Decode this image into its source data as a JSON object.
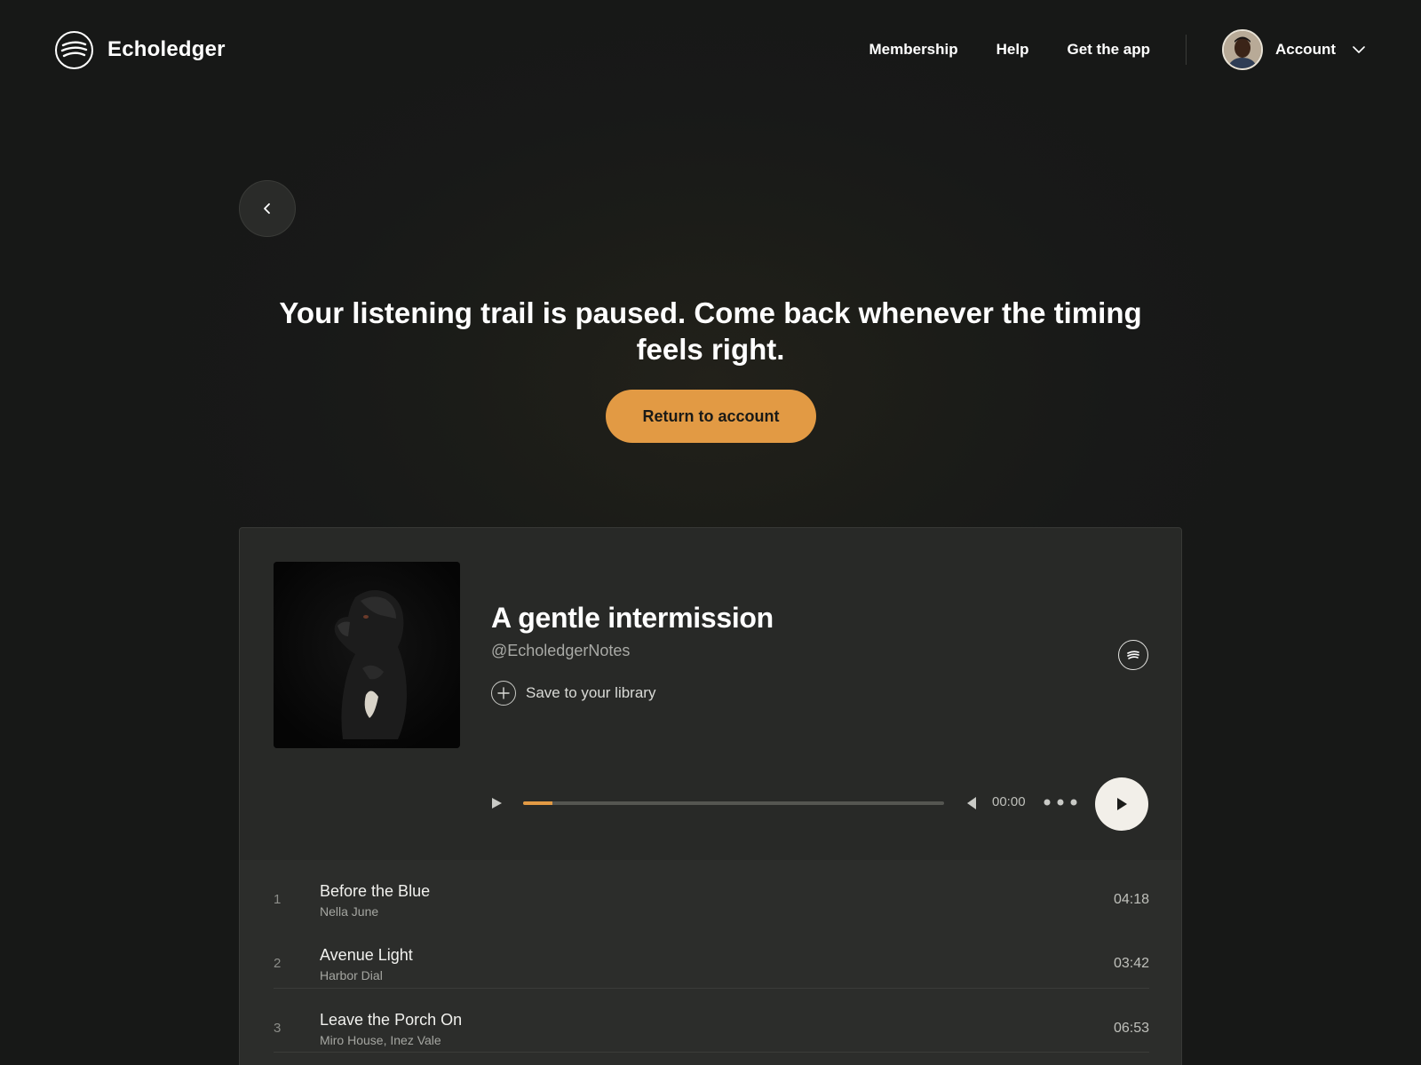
{
  "header": {
    "brand": "Echoledger",
    "nav": [
      "Membership",
      "Help",
      "Get the app"
    ],
    "account_label": "Account"
  },
  "message": {
    "text": "Your listening trail is paused. Come back whenever the timing feels right.",
    "button_label": "Return to account"
  },
  "player": {
    "title": "A gentle intermission",
    "handle": "@EcholedgerNotes",
    "save_label": "Save to your library",
    "time": "00:00",
    "progress": 0.07,
    "tracks": [
      {
        "num": "1",
        "title": "Before the Blue",
        "artist": "Nella June",
        "duration": "04:18"
      },
      {
        "num": "2",
        "title": "Avenue Light",
        "artist": "Harbor Dial",
        "duration": "03:42"
      },
      {
        "num": "3",
        "title": "Leave the Porch On",
        "artist": "Miro House, Inez Vale",
        "duration": "06:53"
      }
    ]
  },
  "colors": {
    "accent": "#e29a44",
    "background": "#181918",
    "card": "#282927"
  },
  "icons": [
    "logo-icon",
    "chevron-down-icon",
    "chevron-left-icon",
    "plus-icon",
    "brand-badge-icon",
    "play-icon",
    "volume-icon",
    "more-icon"
  ]
}
